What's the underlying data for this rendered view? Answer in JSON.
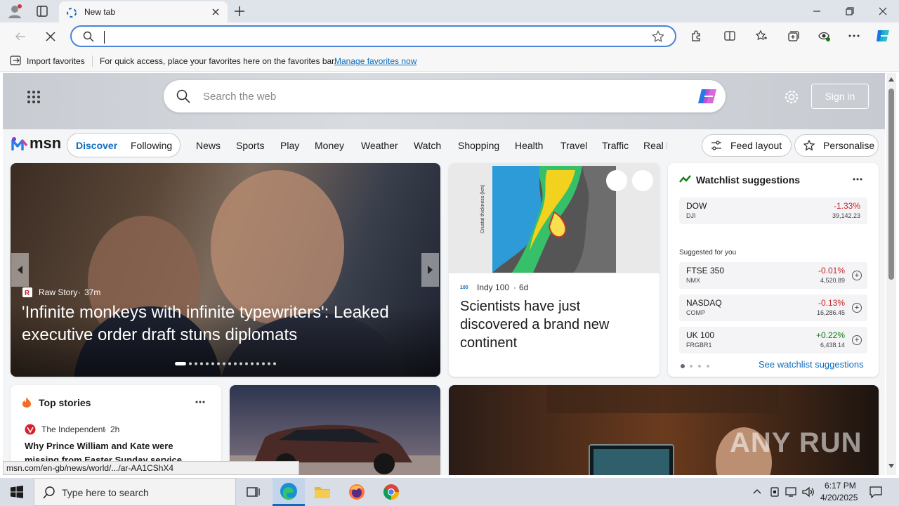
{
  "browser": {
    "tab_title": "New tab",
    "address_value": "",
    "favorites_bar": {
      "import_label": "Import favorites",
      "hint_text": "For quick access, place your favorites here on the favorites bar.",
      "manage_link": "Manage favorites now"
    },
    "status_url": "msn.com/en-gb/news/world/.../ar-AA1CShX4"
  },
  "msn": {
    "search_placeholder": "Search the web",
    "sign_in_label": "Sign in",
    "logo_text": "msn",
    "feed_tabs": [
      "Discover",
      "Following"
    ],
    "nav_items": [
      "News",
      "Sports",
      "Play",
      "Money",
      "Weather",
      "Watch",
      "Shopping",
      "Health",
      "Travel",
      "Traffic",
      "Real E"
    ],
    "feed_layout_label": "Feed layout",
    "personalise_label": "Personalise",
    "hero": {
      "source": "Raw Story",
      "age": "37m",
      "headline": "'Infinite monkeys with infinite typewriters': Leaked executive order draft stuns diplomats"
    },
    "science_card": {
      "source": "Indy 100",
      "age": "6d",
      "headline": "Scientists have just discovered a brand new continent"
    },
    "watchlist": {
      "title": "Watchlist suggestions",
      "suggested_label": "Suggested for you",
      "see_more": "See watchlist suggestions",
      "primary": {
        "name": "DOW",
        "sub": "DJI",
        "change": "-1.33%",
        "value": "39,142.23"
      },
      "items": [
        {
          "name": "FTSE 350",
          "sub": "NMX",
          "change": "-0.01%",
          "value": "4,520.89"
        },
        {
          "name": "NASDAQ",
          "sub": "COMP",
          "change": "-0.13%",
          "value": "16,286.45"
        },
        {
          "name": "UK 100",
          "sub": "FRGBR1",
          "change": "+0.22%",
          "value": "6,438.14"
        }
      ],
      "colors": {
        "negative": "#c62828",
        "positive": "#107c10"
      }
    },
    "top_stories": {
      "title": "Top stories",
      "source": "The Independent",
      "age": "2h",
      "headline": "Why Prince William and Kate were missing from Easter Sunday service"
    }
  },
  "taskbar": {
    "search_placeholder": "Type here to search",
    "time": "6:17 PM",
    "date": "4/20/2025"
  },
  "watermark": "ANY RUN",
  "colors": {
    "accent": "#0f6cbd",
    "link": "#0f6cbd"
  }
}
